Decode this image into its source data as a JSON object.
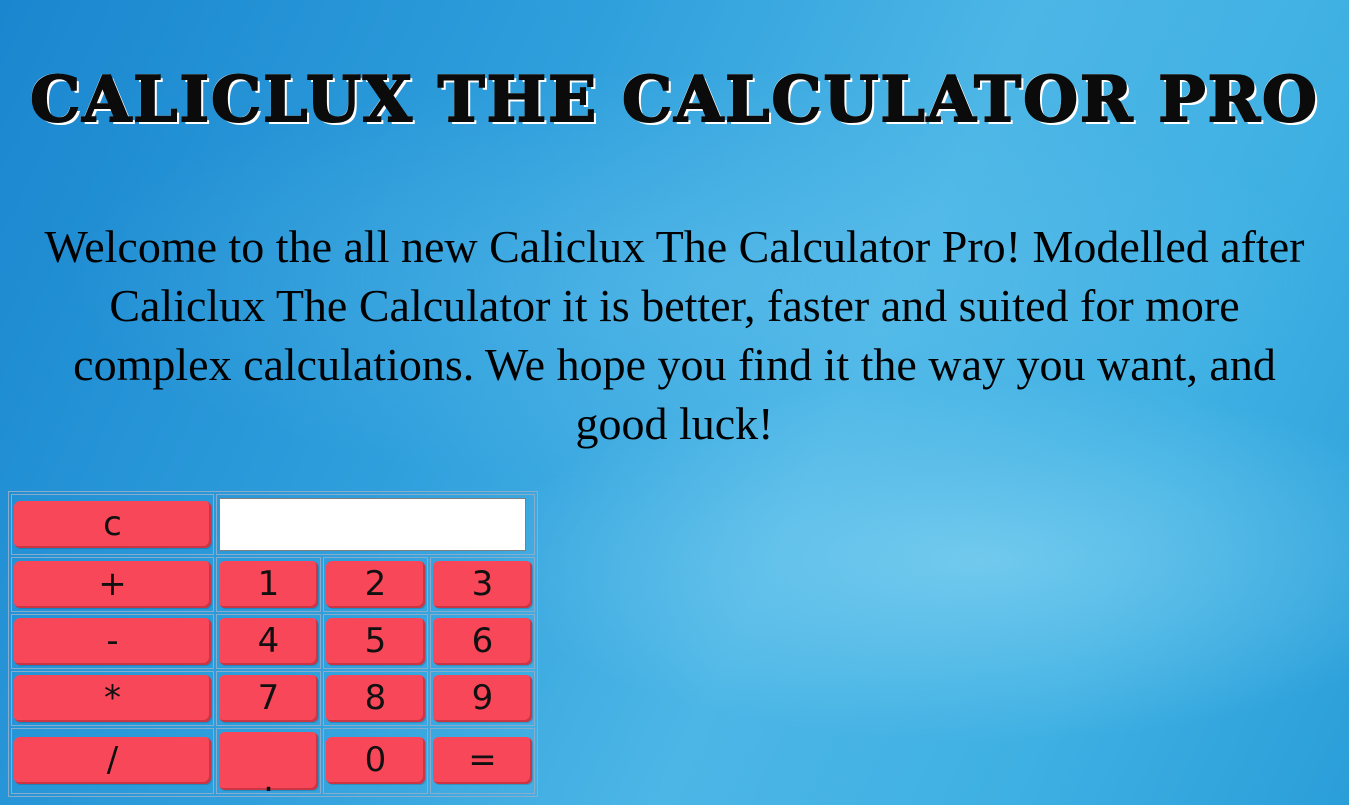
{
  "page": {
    "title": "CALICLUX THE CALCULATOR PRO",
    "intro": "Welcome to the all new Caliclux The Calculator Pro! Modelled after Caliclux The Calculator it is better, faster and suited for more complex calculations. We hope you find it the way you want, and good luck!"
  },
  "calculator": {
    "display_value": "",
    "buttons": {
      "clear": "c",
      "plus": "+",
      "minus": "-",
      "multiply": "*",
      "divide": "/",
      "one": "1",
      "two": "2",
      "three": "3",
      "four": "4",
      "five": "5",
      "six": "6",
      "seven": "7",
      "eight": "8",
      "nine": "9",
      "zero": "0",
      "decimal": ".",
      "equals": "="
    }
  },
  "colors": {
    "button": "#f9475a",
    "background": "#3aaae0",
    "text": "#000000"
  }
}
